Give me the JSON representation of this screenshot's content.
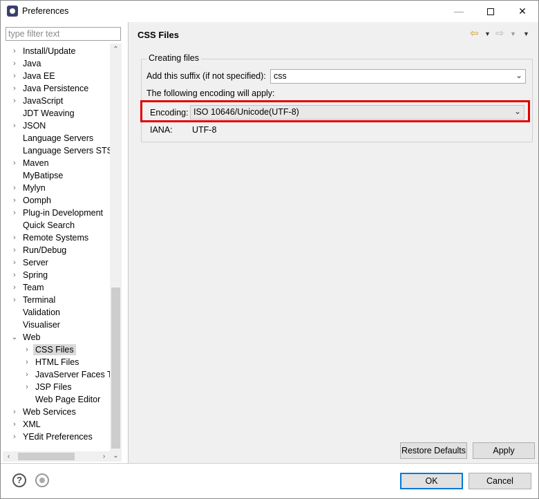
{
  "window": {
    "title": "Preferences",
    "minimize_glyph": "—",
    "close_glyph": "✕"
  },
  "sidebar": {
    "filter_placeholder": "type filter text",
    "items": [
      {
        "label": "Install/Update",
        "expander": "collapsed"
      },
      {
        "label": "Java",
        "expander": "collapsed"
      },
      {
        "label": "Java EE",
        "expander": "collapsed"
      },
      {
        "label": "Java Persistence",
        "expander": "collapsed"
      },
      {
        "label": "JavaScript",
        "expander": "collapsed"
      },
      {
        "label": "JDT Weaving",
        "expander": "none"
      },
      {
        "label": "JSON",
        "expander": "collapsed"
      },
      {
        "label": "Language Servers",
        "expander": "none"
      },
      {
        "label": "Language Servers STS",
        "expander": "none"
      },
      {
        "label": "Maven",
        "expander": "collapsed"
      },
      {
        "label": "MyBatipse",
        "expander": "none"
      },
      {
        "label": "Mylyn",
        "expander": "collapsed"
      },
      {
        "label": "Oomph",
        "expander": "collapsed"
      },
      {
        "label": "Plug-in Development",
        "expander": "collapsed"
      },
      {
        "label": "Quick Search",
        "expander": "none"
      },
      {
        "label": "Remote Systems",
        "expander": "collapsed"
      },
      {
        "label": "Run/Debug",
        "expander": "collapsed"
      },
      {
        "label": "Server",
        "expander": "collapsed"
      },
      {
        "label": "Spring",
        "expander": "collapsed"
      },
      {
        "label": "Team",
        "expander": "collapsed"
      },
      {
        "label": "Terminal",
        "expander": "collapsed"
      },
      {
        "label": "Validation",
        "expander": "none"
      },
      {
        "label": "Visualiser",
        "expander": "none"
      },
      {
        "label": "Web",
        "expander": "expanded"
      },
      {
        "label": "CSS Files",
        "expander": "collapsed",
        "child": true,
        "selected": true
      },
      {
        "label": "HTML Files",
        "expander": "collapsed",
        "child": true
      },
      {
        "label": "JavaServer Faces Tools",
        "expander": "collapsed",
        "child": true
      },
      {
        "label": "JSP Files",
        "expander": "collapsed",
        "child": true
      },
      {
        "label": "Web Page Editor",
        "expander": "none",
        "child": true
      },
      {
        "label": "Web Services",
        "expander": "collapsed"
      },
      {
        "label": "XML",
        "expander": "collapsed"
      },
      {
        "label": "YEdit Preferences",
        "expander": "collapsed"
      }
    ]
  },
  "page": {
    "title": "CSS Files",
    "group_title": "Creating files",
    "suffix_label": "Add this suffix (if not specified):",
    "suffix_value": "css",
    "encoding_note": "The following encoding will apply:",
    "encoding_label": "Encoding:",
    "encoding_value": "ISO 10646/Unicode(UTF-8)",
    "iana_label": "IANA:",
    "iana_value": "UTF-8",
    "restore_defaults": "Restore Defaults",
    "apply": "Apply",
    "highlight_color": "#e00000"
  },
  "footer": {
    "ok": "OK",
    "cancel": "Cancel",
    "help_icon": "?"
  }
}
